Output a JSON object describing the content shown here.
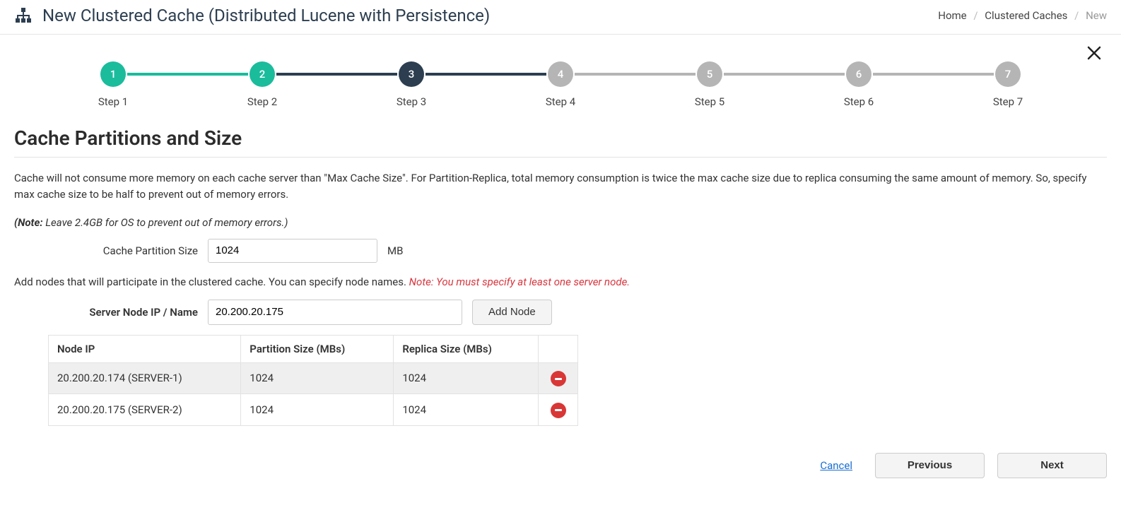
{
  "header": {
    "title": "New Clustered Cache (Distributed Lucene with Persistence)",
    "breadcrumb": {
      "home": "Home",
      "caches": "Clustered Caches",
      "current": "New"
    }
  },
  "stepper": {
    "steps": [
      {
        "num": "1",
        "label": "Step 1",
        "state": "done"
      },
      {
        "num": "2",
        "label": "Step 2",
        "state": "done"
      },
      {
        "num": "3",
        "label": "Step 3",
        "state": "active"
      },
      {
        "num": "4",
        "label": "Step 4",
        "state": "future"
      },
      {
        "num": "5",
        "label": "Step 5",
        "state": "future"
      },
      {
        "num": "6",
        "label": "Step 6",
        "state": "future"
      },
      {
        "num": "7",
        "label": "Step 7",
        "state": "future"
      }
    ]
  },
  "section": {
    "title": "Cache Partitions and Size",
    "description": "Cache will not consume more memory on each cache server than \"Max Cache Size\". For Partition-Replica, total memory consumption is twice the max cache size due to replica consuming the same amount of memory. So, specify max cache size to be half to prevent out of memory errors.",
    "note_label": "(Note:",
    "note_text": " Leave 2.4GB for OS to prevent out of memory errors.)",
    "partition_size_label": "Cache Partition Size",
    "partition_size_value": "1024",
    "partition_size_unit": "MB",
    "add_nodes_text": "Add nodes that will participate in the clustered cache. You can specify node names. ",
    "add_nodes_warning": "Note: You must specify at least one server node.",
    "server_node_label": "Server Node IP / Name",
    "server_node_value": "20.200.20.175",
    "add_node_button": "Add Node"
  },
  "table": {
    "headers": {
      "node_ip": "Node IP",
      "partition_size": "Partition Size (MBs)",
      "replica_size": "Replica Size (MBs)"
    },
    "rows": [
      {
        "ip": "20.200.20.174 (SERVER-1)",
        "partition": "1024",
        "replica": "1024"
      },
      {
        "ip": "20.200.20.175 (SERVER-2)",
        "partition": "1024",
        "replica": "1024"
      }
    ]
  },
  "footer": {
    "cancel": "Cancel",
    "previous": "Previous",
    "next": "Next"
  }
}
